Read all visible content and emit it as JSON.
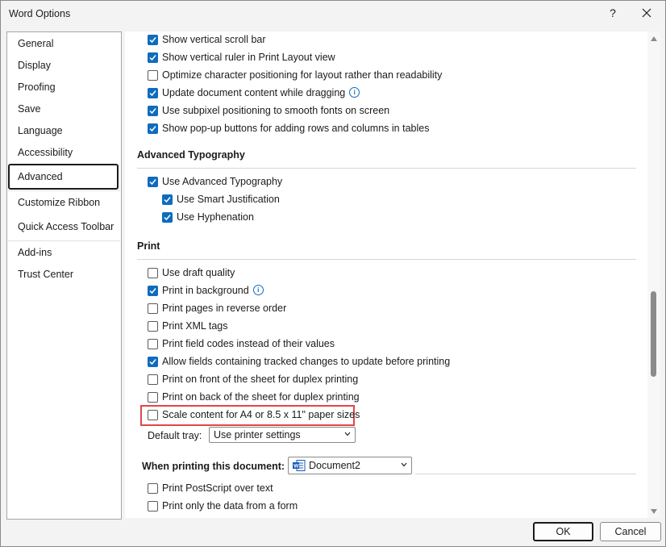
{
  "window": {
    "title": "Word Options",
    "help": "?"
  },
  "sidebar": {
    "items": [
      {
        "label": "General"
      },
      {
        "label": "Display"
      },
      {
        "label": "Proofing"
      },
      {
        "label": "Save"
      },
      {
        "label": "Language"
      },
      {
        "label": "Accessibility"
      },
      {
        "label": "Advanced",
        "selected": true
      },
      {
        "label": "Customize Ribbon"
      },
      {
        "label": "Quick Access Toolbar"
      },
      {
        "label": "Add-ins"
      },
      {
        "label": "Trust Center"
      }
    ]
  },
  "display_options": [
    {
      "label": "Show vertical scroll bar",
      "checked": true
    },
    {
      "label": "Show vertical ruler in Print Layout view",
      "checked": true
    },
    {
      "label": "Optimize character positioning for layout rather than readability",
      "checked": false
    },
    {
      "label": "Update document content while dragging",
      "checked": true,
      "info": true
    },
    {
      "label": "Use subpixel positioning to smooth fonts on screen",
      "checked": true
    },
    {
      "label": "Show pop-up buttons for adding rows and columns in tables",
      "checked": true
    }
  ],
  "advanced_typography": {
    "heading": "Advanced Typography",
    "options": [
      {
        "label": "Use Advanced Typography",
        "checked": true
      },
      {
        "label": "Use Smart Justification",
        "checked": true
      },
      {
        "label": "Use Hyphenation",
        "checked": true
      }
    ]
  },
  "print": {
    "heading": "Print",
    "options": [
      {
        "label": "Use draft quality",
        "checked": false
      },
      {
        "label": "Print in background",
        "checked": true,
        "info": true
      },
      {
        "label": "Print pages in reverse order",
        "checked": false
      },
      {
        "label": "Print XML tags",
        "checked": false
      },
      {
        "label": "Print field codes instead of their values",
        "checked": false
      },
      {
        "label": "Allow fields containing tracked changes to update before printing",
        "checked": true
      },
      {
        "label": "Print on front of the sheet for duplex printing",
        "checked": false
      },
      {
        "label": "Print on back of the sheet for duplex printing",
        "checked": false
      },
      {
        "label": "Scale content for A4 or 8.5 x 11\" paper sizes",
        "checked": false
      }
    ],
    "default_tray": {
      "label": "Default tray:",
      "value": "Use printer settings"
    }
  },
  "when_printing": {
    "label": "When printing this document:",
    "document": "Document2",
    "options": [
      {
        "label": "Print PostScript over text",
        "checked": false
      },
      {
        "label": "Print only the data from a form",
        "checked": false
      }
    ]
  },
  "buttons": {
    "ok": "OK",
    "cancel": "Cancel"
  },
  "colors": {
    "accent": "#0f6cbd",
    "highlight": "#e0464a"
  },
  "icons": [
    "help-icon",
    "close-icon",
    "info-icon",
    "checkmark-icon",
    "chevron-down-icon",
    "word-document-icon",
    "scroll-up-icon",
    "scroll-down-icon"
  ]
}
